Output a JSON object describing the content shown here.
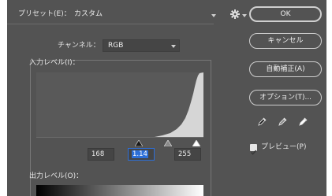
{
  "preset": {
    "label": "プリセット(E)：",
    "value": "カスタム"
  },
  "buttons": {
    "ok": "OK",
    "cancel": "キャンセル",
    "auto": "自動補正(A)",
    "options": "オプション(T)..."
  },
  "channel": {
    "label": "チャンネル：",
    "value": "RGB"
  },
  "input_levels": {
    "label": "入力レベル(I)：",
    "black": "168",
    "gamma": "1.14",
    "white": "255"
  },
  "preview": {
    "label": "プレビュー(P)",
    "checked": true
  },
  "output_levels": {
    "label": "出力レベル(O)："
  },
  "colors": {
    "panel": "#535353",
    "histogram_fill": "#d6d6d6",
    "selection": "#2d6fd8"
  },
  "icons": [
    "gear-icon",
    "black-eyedropper-icon",
    "gray-eyedropper-icon",
    "white-eyedropper-icon"
  ]
}
